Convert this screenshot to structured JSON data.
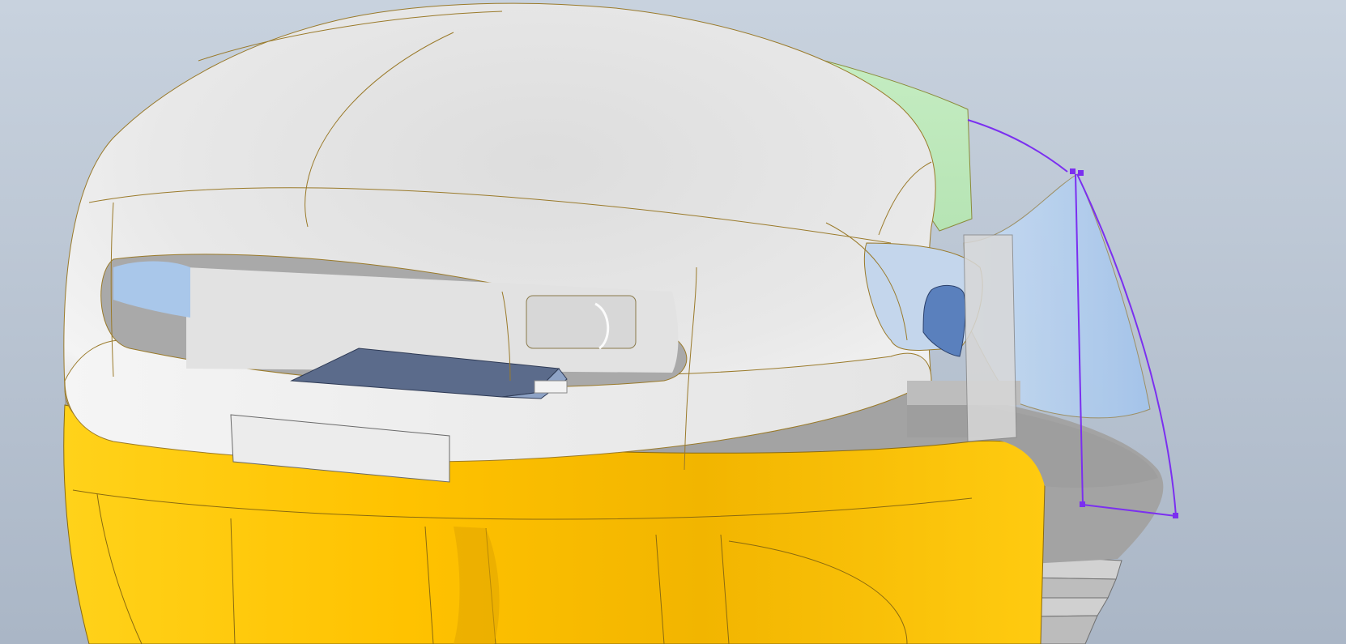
{
  "viewport": {
    "background_top": "#c8d2de",
    "background_bottom": "#aab6c6"
  },
  "model": {
    "shell_color": "#e6e6e6",
    "shell_shadow": "#bdbdbd",
    "edge_color": "#9a7a2a",
    "base_color": "#ffc400",
    "base_shadow": "#e0a400",
    "accent_green": "#c4ecc4",
    "floor_gray": "#a2a2a2",
    "glass_blue": "#aacbee",
    "part_blue": "#5a80bd",
    "panel_slate": "#5a6a8a"
  },
  "sketch": {
    "color": "#7b2ff0"
  }
}
